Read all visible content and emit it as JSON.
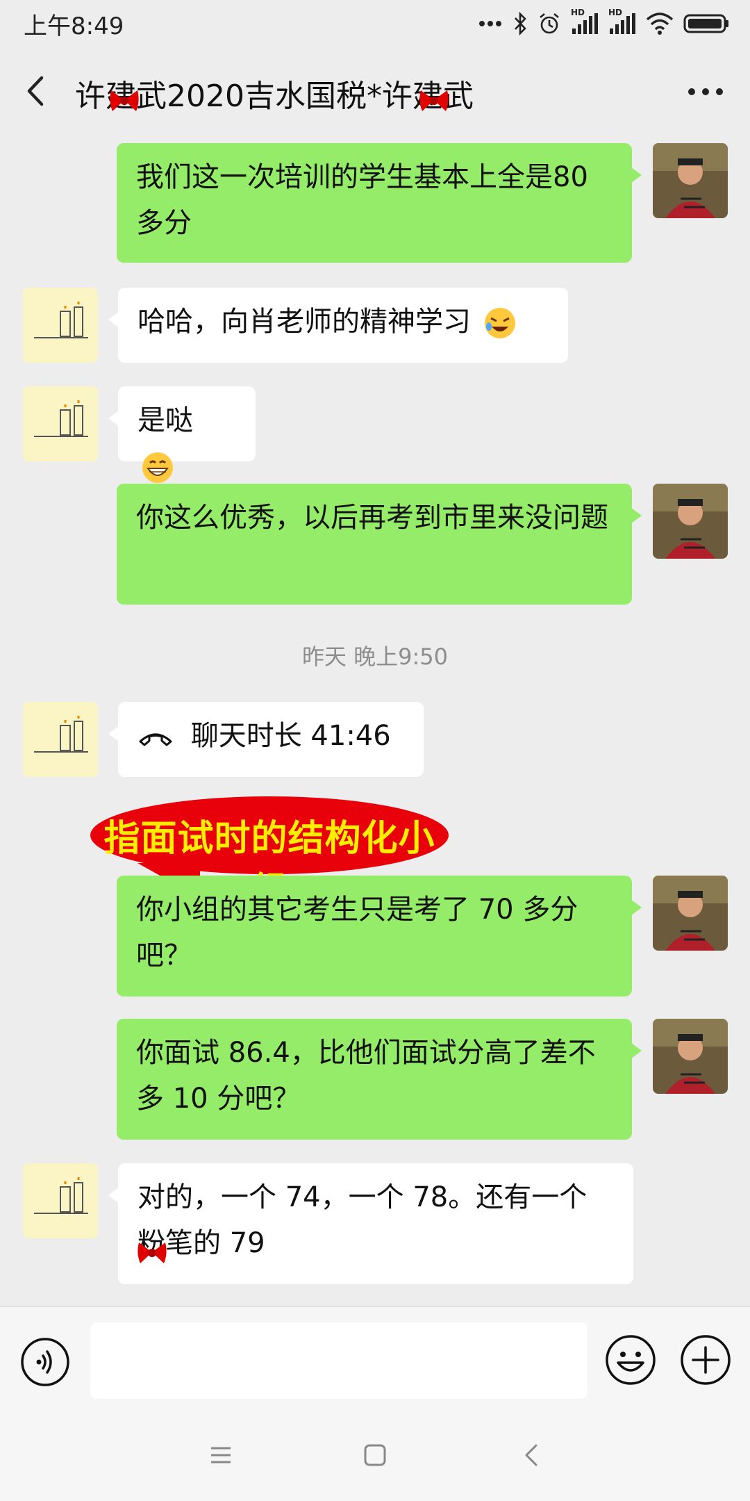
{
  "status_bar": {
    "time": "上午8:49",
    "hd_label": "HD"
  },
  "header": {
    "title": "许建武2020吉水国税*许建武"
  },
  "messages": [
    {
      "side": "right",
      "text": "我们这一次培训的学生基本上全是80 多分"
    },
    {
      "side": "left",
      "text": "哈哈，向肖老师的精神学习",
      "emoji": "weary-laughing-emoji"
    },
    {
      "side": "left",
      "text": "是哒",
      "emoji": "grinning-emoji"
    },
    {
      "side": "right",
      "text": "你这么优秀，以后再考到市里来没问题"
    },
    {
      "side": "left",
      "text": "聊天时长 41:46",
      "icon": "phone-hangup-icon"
    },
    {
      "side": "right",
      "text": "你小组的其它考生只是考了 70 多分吧？"
    },
    {
      "side": "right",
      "text": "你面试 86.4，比他们面试分高了差不多 10 分吧？"
    },
    {
      "side": "left",
      "text": "对的，一个 74，一个 78。还有一个粉笔的 79"
    }
  ],
  "timestamp": "昨天 晚上9:50",
  "annotation": {
    "text": "指面试时的结构化小组",
    "bg_color": "#e8000a",
    "text_color": "#ffee00"
  },
  "colors": {
    "background": "#ededed",
    "self_bubble": "#95ec69",
    "other_bubble": "#ffffff"
  },
  "input": {
    "value": ""
  }
}
